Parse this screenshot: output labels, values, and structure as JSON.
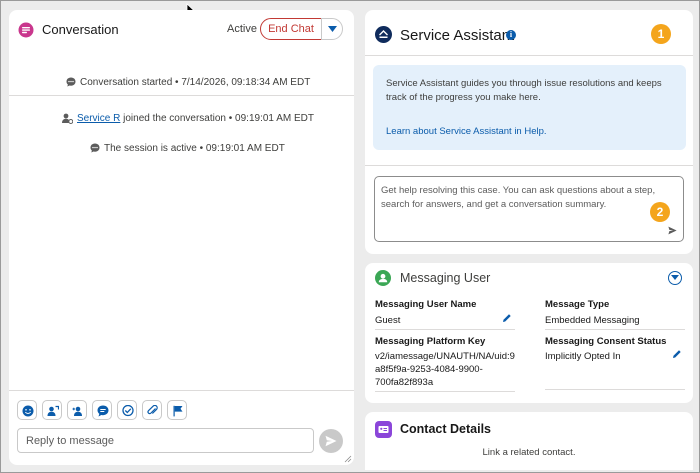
{
  "conversation": {
    "title": "Conversation",
    "status": "Active",
    "end_chat_label": "End Chat",
    "events": {
      "started": "Conversation started • 7/14/2026, 09:18:34 AM EDT",
      "joined_agent": "Service R",
      "joined_text": " joined the conversation • 09:19:01 AM EDT",
      "session_active": "The session is active • 09:19:01 AM EDT"
    },
    "toolbar_icons": [
      "emoji-icon",
      "transfer-icon",
      "add-user-icon",
      "quick-text-icon",
      "knowledge-icon",
      "attachment-icon",
      "flag-icon"
    ],
    "reply_placeholder": "Reply to message"
  },
  "assistant": {
    "title": "Service Assistant",
    "badge_1": "1",
    "badge_2": "2",
    "info_text": "Service Assistant guides you through issue resolutions and keeps track of the progress you make here.",
    "info_link": "Learn about Service Assistant in Help.",
    "prompt_text": "Get help resolving this case. You can ask questions about a step, search for answers, and get a conversation summary."
  },
  "messaging_user": {
    "title": "Messaging User",
    "fields": {
      "user_name_label": "Messaging User Name",
      "user_name_value": "Guest",
      "message_type_label": "Message Type",
      "message_type_value": "Embedded Messaging",
      "platform_key_label": "Messaging Platform Key",
      "platform_key_line1": "v2/iamessage/UNAUTH/NA/uid:9",
      "platform_key_line2": "a8f5f9a-9253-4084-9900-",
      "platform_key_line3": "700fa82f893a",
      "consent_label": "Messaging Consent Status",
      "consent_value": "Implicitly Opted In"
    }
  },
  "contact": {
    "title": "Contact Details",
    "subtitle": "Link a related contact."
  },
  "colors": {
    "end_chat": "#c23934",
    "link": "#0b5cab",
    "badge": "#f4a51c",
    "info_bg": "#e4f0fb",
    "messaging_icon": "#3ba755",
    "contact_icon": "#8b46d9"
  }
}
